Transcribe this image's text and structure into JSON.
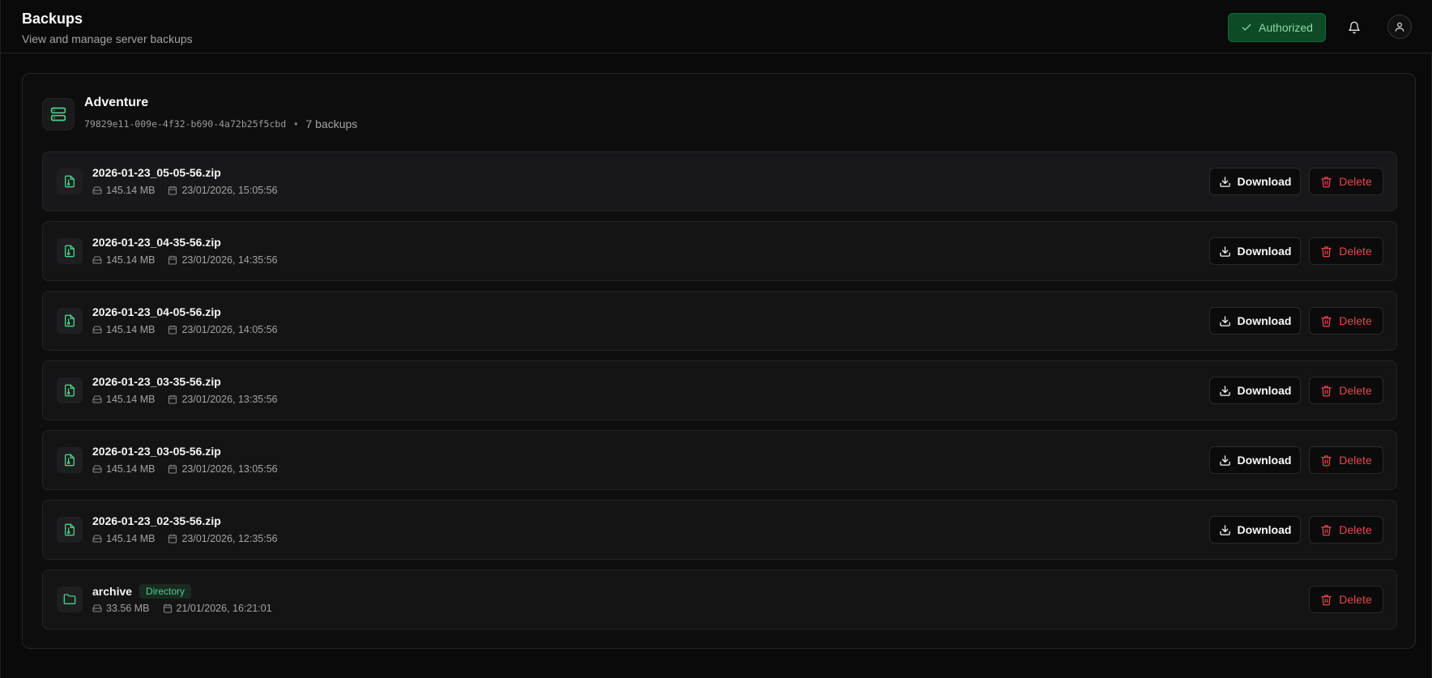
{
  "header": {
    "title": "Backups",
    "subtitle": "View and manage server backups",
    "auth_label": "Authorized"
  },
  "server": {
    "name": "Adventure",
    "id": "79829e11-009e-4f32-b690-4a72b25f5cbd",
    "separator": "•",
    "count_label": "7 backups"
  },
  "actions": {
    "download_label": "Download",
    "delete_label": "Delete"
  },
  "backups": [
    {
      "name": "2026-01-23_05-05-56.zip",
      "size": "145.14 MB",
      "date": "23/01/2026, 15:05:56",
      "type": "file",
      "badge": ""
    },
    {
      "name": "2026-01-23_04-35-56.zip",
      "size": "145.14 MB",
      "date": "23/01/2026, 14:35:56",
      "type": "file",
      "badge": ""
    },
    {
      "name": "2026-01-23_04-05-56.zip",
      "size": "145.14 MB",
      "date": "23/01/2026, 14:05:56",
      "type": "file",
      "badge": ""
    },
    {
      "name": "2026-01-23_03-35-56.zip",
      "size": "145.14 MB",
      "date": "23/01/2026, 13:35:56",
      "type": "file",
      "badge": ""
    },
    {
      "name": "2026-01-23_03-05-56.zip",
      "size": "145.14 MB",
      "date": "23/01/2026, 13:05:56",
      "type": "file",
      "badge": ""
    },
    {
      "name": "2026-01-23_02-35-56.zip",
      "size": "145.14 MB",
      "date": "23/01/2026, 12:35:56",
      "type": "file",
      "badge": ""
    },
    {
      "name": "archive",
      "size": "33.56 MB",
      "date": "21/01/2026, 16:21:01",
      "type": "directory",
      "badge": "Directory"
    }
  ],
  "colors": {
    "accent_green": "#4ad08a",
    "authorized_bg": "#0d4a26",
    "danger": "#e5484d",
    "background": "#0a0a0a"
  },
  "icons": {
    "auth": "check-icon",
    "notifications": "bell-icon",
    "account": "user-icon",
    "server": "server-icon",
    "file": "file-archive-icon",
    "directory": "folder-icon",
    "size": "hard-drive-icon",
    "date": "calendar-icon",
    "download": "download-icon",
    "delete": "trash-icon"
  }
}
